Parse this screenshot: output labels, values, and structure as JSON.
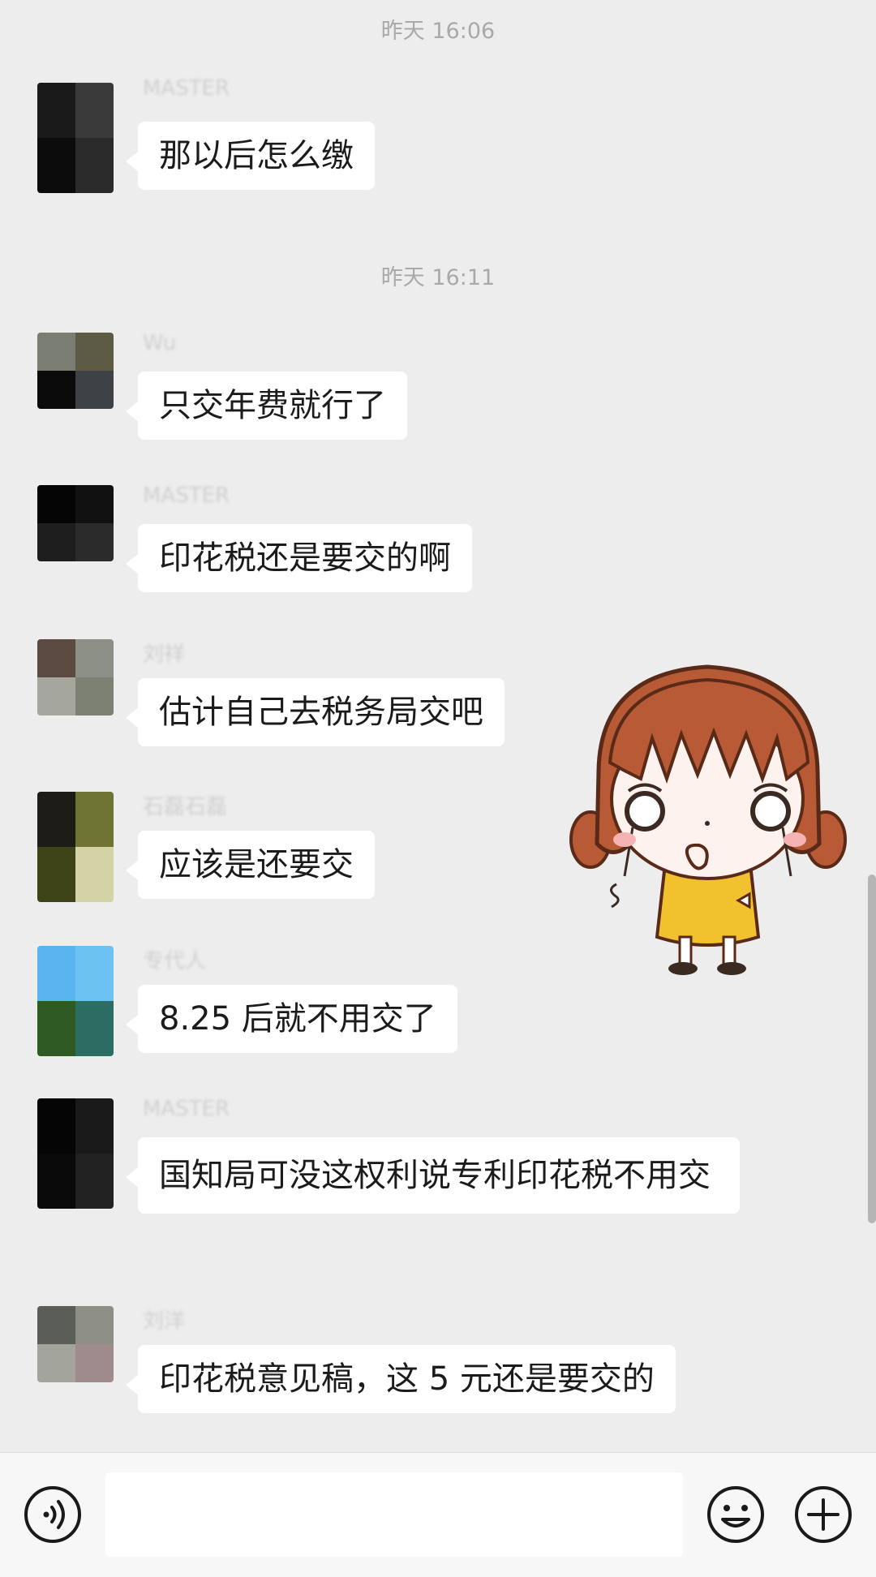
{
  "chat": {
    "top_timestamp": "昨天 16:06",
    "timestamp": "昨天 16:11",
    "messages": [
      {
        "sender": "MASTER",
        "text": "那以后怎么缴"
      },
      {
        "sender": "Wu",
        "text": "只交年费就行了"
      },
      {
        "sender": "MASTER",
        "text": "印花税还是要交的啊"
      },
      {
        "sender": "刘祥",
        "text": "估计自己去税务局交吧"
      },
      {
        "sender": "石磊石磊",
        "text": "应该是还要交"
      },
      {
        "sender": "专代人",
        "text": "8.25 后就不用交了"
      },
      {
        "sender": "MASTER",
        "text": "国知局可没这权利说专利印花税不用交"
      },
      {
        "sender": "刘洋",
        "text": "印花税意见稿，这 5 元还是要交的"
      }
    ]
  },
  "avatars": [
    [
      "#1a1a1a",
      "#3a3a3a",
      "#0c0c0c",
      "#2a2a2a"
    ],
    [
      "#7a7d72",
      "#5d5b45",
      "#0b0b0c",
      "#3e4146"
    ],
    [
      "#050505",
      "#111111",
      "#1e1e1e",
      "#2b2b2b"
    ],
    [
      "#5a4a40",
      "#8c8f86",
      "#a5a69d",
      "#7d8174"
    ],
    [
      "#1e1c17",
      "#707433",
      "#3f4418",
      "#d3d3a5"
    ],
    [
      "#5ab4f0",
      "#6cc3f2",
      "#2f5a24",
      "#2b6d62"
    ],
    [
      "#050505",
      "#1a1a1a",
      "#0a0a0a",
      "#222222"
    ],
    [
      "#5b5e57",
      "#8d8f85",
      "#a3a59c",
      "#9f8a8c"
    ]
  ],
  "input_bar": {
    "voice_icon": "voice-icon",
    "emoji_icon": "emoji-icon",
    "plus_icon": "plus-icon",
    "input_value": ""
  },
  "sticker": {
    "description_icon": "crying-girl-sticker"
  }
}
